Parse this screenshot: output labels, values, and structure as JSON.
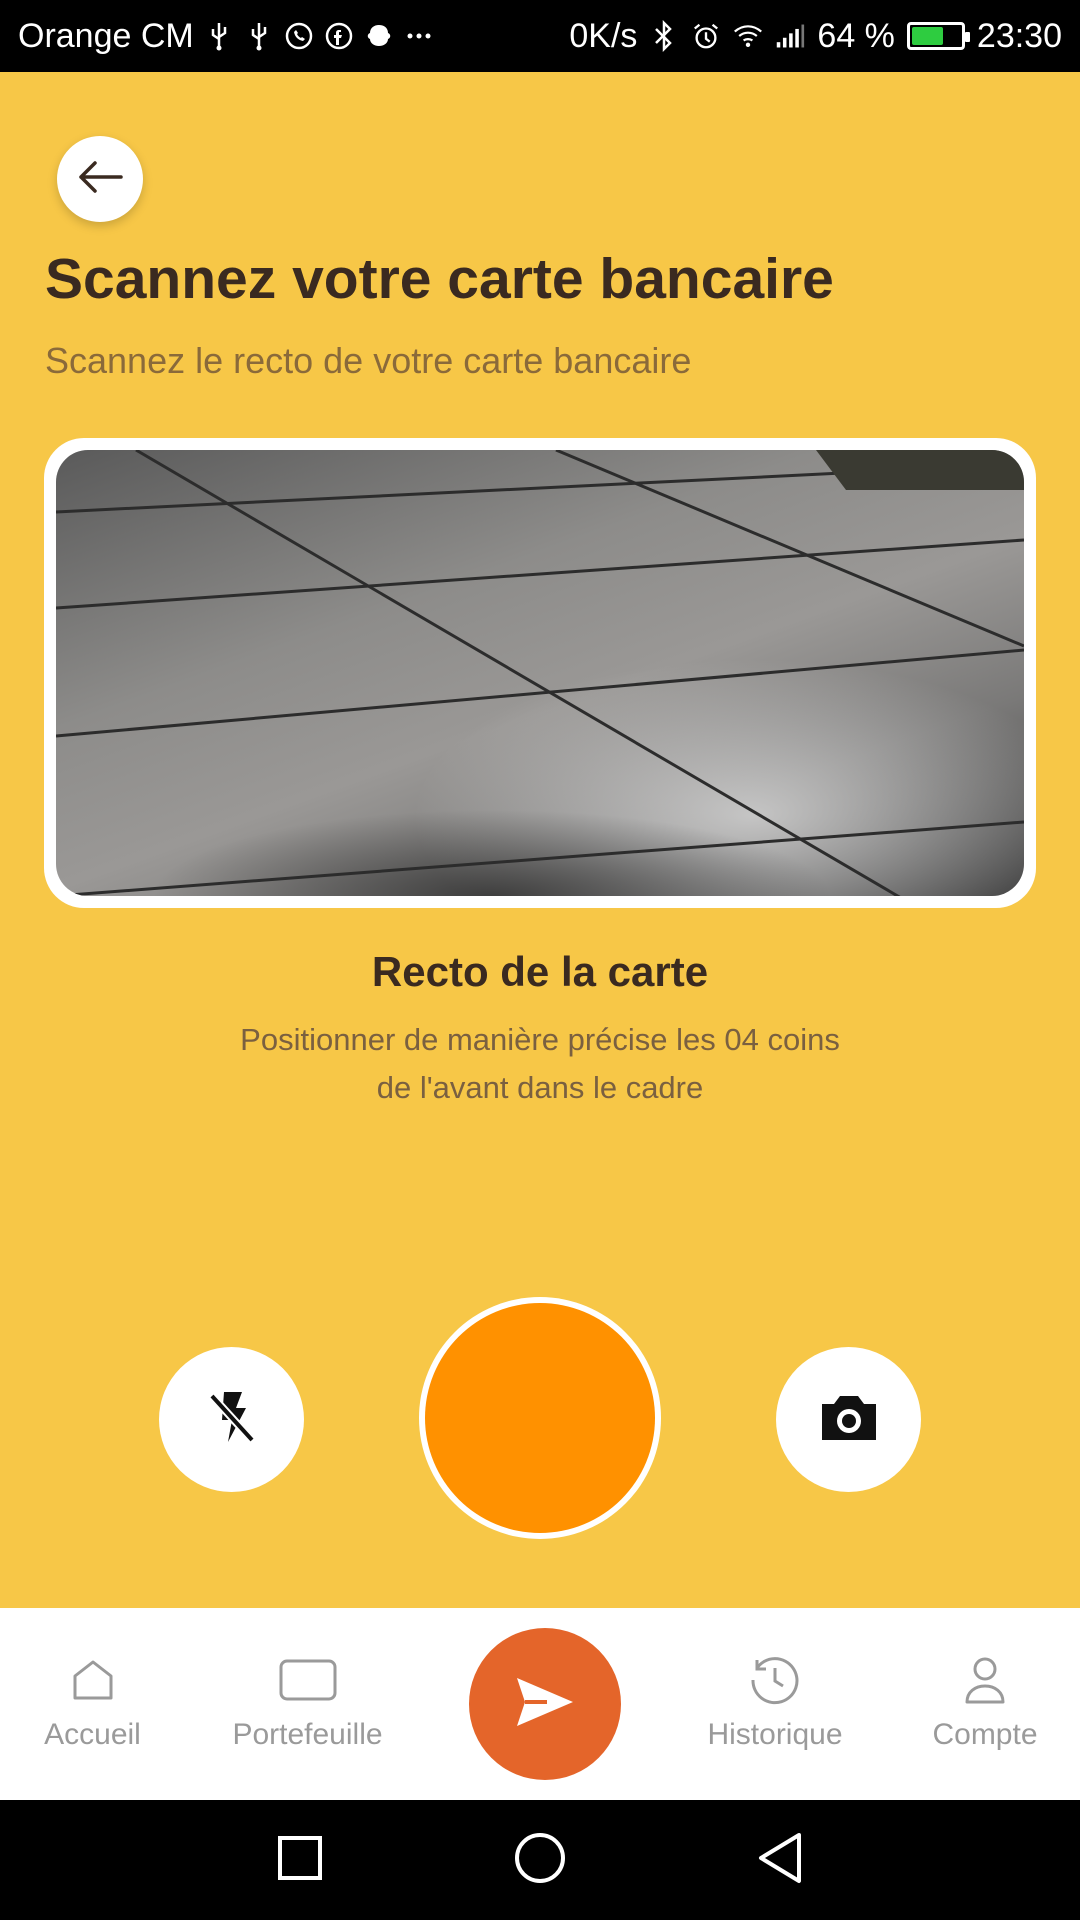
{
  "status_bar": {
    "carrier": "Orange CM",
    "notification_icons": [
      "usb-icon",
      "usb-icon",
      "whatsapp-icon",
      "facebook-icon",
      "app-icon",
      "more-icon"
    ],
    "net_speed": "0K/s",
    "battery_pct": "64 %",
    "battery_level": 0.64,
    "time": "23:30"
  },
  "header": {
    "title": "Scannez votre carte bancaire",
    "subtitle": "Scannez le recto de votre carte bancaire"
  },
  "scanner": {
    "label": "Recto de la carte",
    "hint": "Positionner de manière précise les 04 coins de l'avant dans le cadre"
  },
  "controls": {
    "flash_icon": "flash-off-icon",
    "shutter_color": "#FF9100",
    "switch_icon": "camera-icon"
  },
  "bottom_nav": {
    "items": [
      {
        "label": "Accueil",
        "icon": "home-icon"
      },
      {
        "label": "Portefeuille",
        "icon": "wallet-icon"
      },
      {
        "label": "Historique",
        "icon": "history-icon"
      },
      {
        "label": "Compte",
        "icon": "user-icon"
      }
    ],
    "send_icon": "send-icon",
    "send_color": "#E4652A"
  },
  "colors": {
    "background": "#F7C747",
    "title": "#3A2A20",
    "accent": "#FF9100"
  }
}
